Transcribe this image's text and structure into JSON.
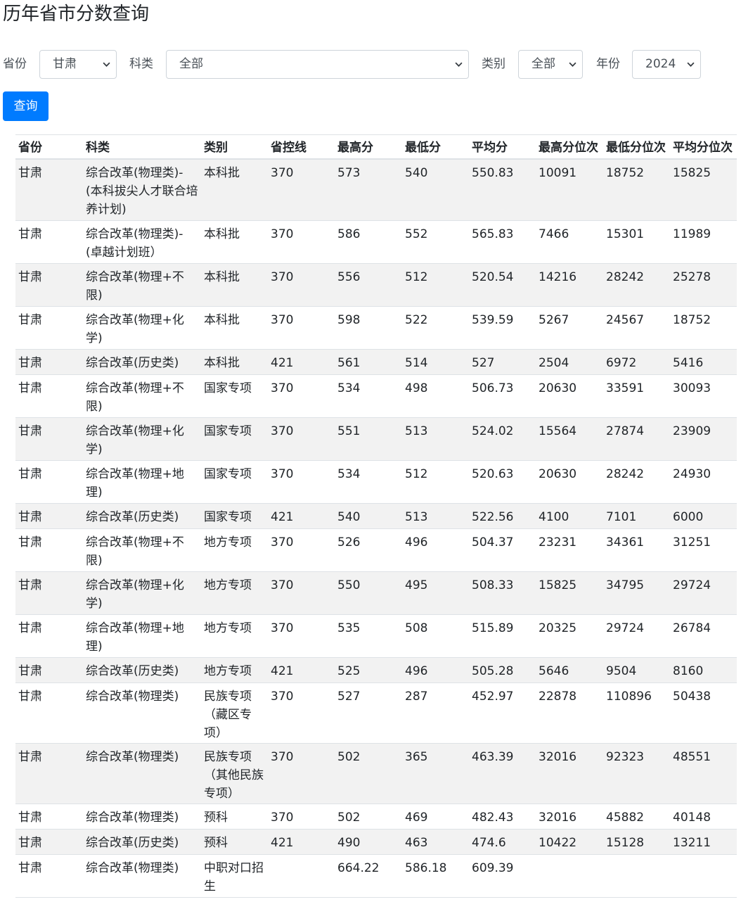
{
  "page_title": "历年省市分数查询",
  "filters": {
    "province_label": "省份",
    "province_value": "甘肃",
    "subject_label": "科类",
    "subject_value": "全部",
    "category_label": "类别",
    "category_value": "全部",
    "year_label": "年份",
    "year_value": "2024"
  },
  "query_button": "查询",
  "table": {
    "headers": [
      "省份",
      "科类",
      "类别",
      "省控线",
      "最高分",
      "最低分",
      "平均分",
      "最高分位次",
      "最低分位次",
      "平均分位次"
    ],
    "rows": [
      [
        "甘肃",
        "综合改革(物理类)-(本科拔尖人才联合培养计划)",
        "本科批",
        "370",
        "573",
        "540",
        "550.83",
        "10091",
        "18752",
        "15825"
      ],
      [
        "甘肃",
        "综合改革(物理类)-(卓越计划班）",
        "本科批",
        "370",
        "586",
        "552",
        "565.83",
        "7466",
        "15301",
        "11989"
      ],
      [
        "甘肃",
        "综合改革(物理+不限)",
        "本科批",
        "370",
        "556",
        "512",
        "520.54",
        "14216",
        "28242",
        "25278"
      ],
      [
        "甘肃",
        "综合改革(物理+化学)",
        "本科批",
        "370",
        "598",
        "522",
        "539.59",
        "5267",
        "24567",
        "18752"
      ],
      [
        "甘肃",
        "综合改革(历史类)",
        "本科批",
        "421",
        "561",
        "514",
        "527",
        "2504",
        "6972",
        "5416"
      ],
      [
        "甘肃",
        "综合改革(物理+不限)",
        "国家专项",
        "370",
        "534",
        "498",
        "506.73",
        "20630",
        "33591",
        "30093"
      ],
      [
        "甘肃",
        "综合改革(物理+化学)",
        "国家专项",
        "370",
        "551",
        "513",
        "524.02",
        "15564",
        "27874",
        "23909"
      ],
      [
        "甘肃",
        "综合改革(物理+地理)",
        "国家专项",
        "370",
        "534",
        "512",
        "520.63",
        "20630",
        "28242",
        "24930"
      ],
      [
        "甘肃",
        "综合改革(历史类)",
        "国家专项",
        "421",
        "540",
        "513",
        "522.56",
        "4100",
        "7101",
        "6000"
      ],
      [
        "甘肃",
        "综合改革(物理+不限)",
        "地方专项",
        "370",
        "526",
        "496",
        "504.37",
        "23231",
        "34361",
        "31251"
      ],
      [
        "甘肃",
        "综合改革(物理+化学)",
        "地方专项",
        "370",
        "550",
        "495",
        "508.33",
        "15825",
        "34795",
        "29724"
      ],
      [
        "甘肃",
        "综合改革(物理+地理)",
        "地方专项",
        "370",
        "535",
        "508",
        "515.89",
        "20325",
        "29724",
        "26784"
      ],
      [
        "甘肃",
        "综合改革(历史类)",
        "地方专项",
        "421",
        "525",
        "496",
        "505.28",
        "5646",
        "9504",
        "8160"
      ],
      [
        "甘肃",
        "综合改革(物理类)",
        "民族专项（藏区专项）",
        "370",
        "527",
        "287",
        "452.97",
        "22878",
        "110896",
        "50438"
      ],
      [
        "甘肃",
        "综合改革(物理类)",
        "民族专项（其他民族专项）",
        "370",
        "502",
        "365",
        "463.39",
        "32016",
        "92323",
        "48551"
      ],
      [
        "甘肃",
        "综合改革(物理类)",
        "预科",
        "370",
        "502",
        "469",
        "482.43",
        "32016",
        "45882",
        "40148"
      ],
      [
        "甘肃",
        "综合改革(历史类)",
        "预科",
        "421",
        "490",
        "463",
        "474.6",
        "10422",
        "15128",
        "13211"
      ],
      [
        "甘肃",
        "综合改革(物理类)",
        "中职对口招生",
        "",
        "664.22",
        "586.18",
        "609.39",
        "",
        "",
        ""
      ]
    ]
  }
}
